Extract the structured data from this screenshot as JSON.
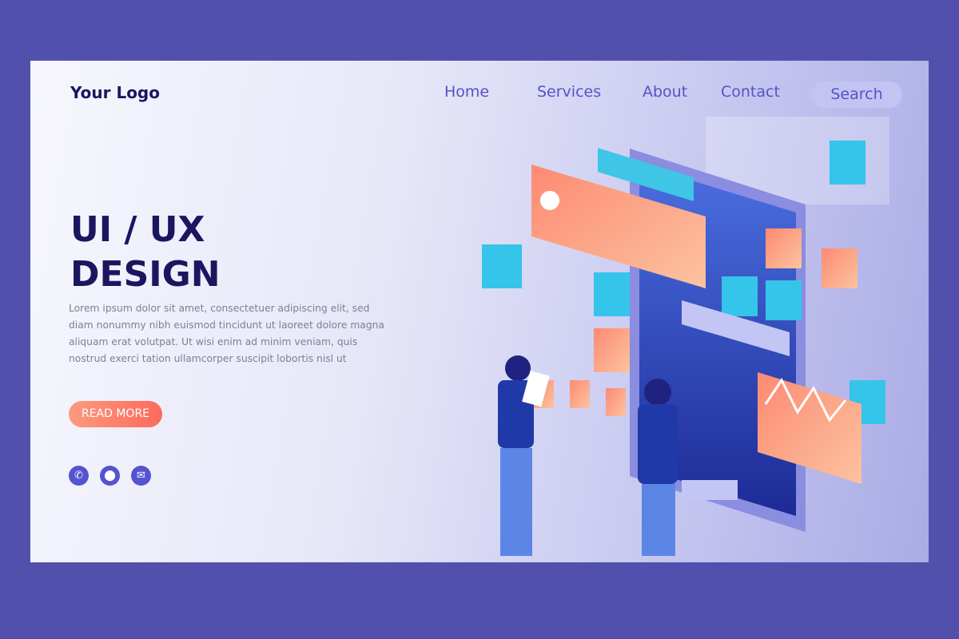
{
  "header": {
    "logo": "Your Logo",
    "nav": [
      "Home",
      "Services",
      "About",
      "Contact"
    ],
    "search_label": "Search"
  },
  "hero": {
    "title_line1": "UI / UX",
    "title_line2": "DESIGN",
    "body": "Lorem ipsum dolor sit amet, consectetuer adipiscing elit, sed diam nonummy nibh euismod tincidunt ut laoreet dolore magna aliquam erat volutpat. Ut wisi enim ad minim veniam, quis nostrud exerci tation ullamcorper suscipit lobortis nisl ut",
    "cta": "READ MORE"
  },
  "contact_icons": [
    "phone-icon",
    "location-icon",
    "mail-icon"
  ],
  "colors": {
    "background": "#5151ad",
    "title": "#1b1660",
    "accent": "#5553c7",
    "cta": "#fd6a5c"
  }
}
